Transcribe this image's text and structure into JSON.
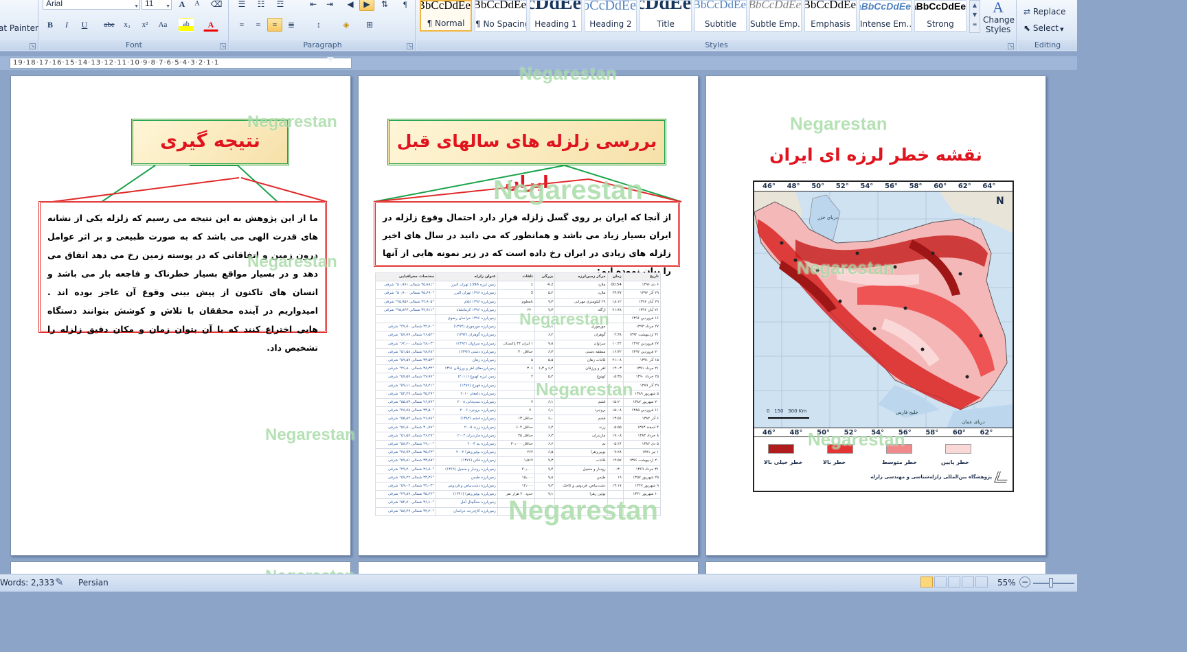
{
  "ribbon": {
    "clipboard": {
      "format_painter": "at Painter"
    },
    "font": {
      "family": "Arial",
      "size": "11",
      "group_label": "Font",
      "buttons": [
        "B",
        "I",
        "U",
        "abe",
        "x₂",
        "x²",
        "Aa",
        "ab",
        "A"
      ],
      "grow": "A",
      "shrink": "A"
    },
    "paragraph": {
      "group_label": "Paragraph"
    },
    "styles": {
      "group_label": "Styles",
      "tiles": [
        {
          "sample": "AaBbCcDdEe",
          "name": "¶ Normal"
        },
        {
          "sample": "AaBbCcDdEe",
          "name": "¶ No Spacing"
        },
        {
          "sample": "AaBbCcDdEe",
          "name": "Heading 1"
        },
        {
          "sample": "AaBbCcDdEe",
          "name": "Heading 2"
        },
        {
          "sample": "AaBbCcDdEe",
          "name": "Title"
        },
        {
          "sample": "AaBbCcDdEe",
          "name": "Subtitle"
        },
        {
          "sample": "AaBbCcDdEe",
          "name": "Subtle Emp..."
        },
        {
          "sample": "AaBbCcDdEe",
          "name": "Emphasis"
        },
        {
          "sample": "AaBbCcDdEe",
          "name": "Intense Em..."
        },
        {
          "sample": "AaBbCcDdEe",
          "name": "Strong"
        }
      ],
      "change_styles": "Change Styles"
    },
    "editing": {
      "group_label": "Editing",
      "replace": "Replace",
      "select": "Select"
    }
  },
  "ruler": {
    "text": "19·18·17·16·15·14·13·12·11·10·9·8·7·6·5·4·3·2·1·1"
  },
  "watermark": "Negarestan",
  "pages": {
    "left": {
      "banner": "نتیجه گیری",
      "body": "ما از این پژوهش به این نتیجه می رسیم که زلزله یکی از نشانه های قدرت الهی می باشد که به صورت طبیعی و بر اثر عوامل درون زمین و اتفاقاتی که در پوسته زمین رخ می دهد اتفاق می دهد و در بسیار مواقع بسیار خطرناک و فاجعه بار می باشد و انسان های تاکنون از پیش بینی وقوع آن عاجز بوده اند . امیدواریم در آینده محققان با تلاش و کوشش بتوانند دستگاه هایی اختراع کنند که با آن بتوان زمان و مکان دقیق زلزله را تشخیص داد."
    },
    "middle": {
      "banner": "بررسی زلزله های سالهای قبل ایران",
      "body": "از آنجا که ایران بر روی گسل زلزله قرار دارد احتمال وقوع زلزله در ایران بسیار زیاد می باشد و همانطور که می دانید در سال های اخیر زلزله های زیادی در ایران رخ داده است که در زیر نمونه هایی از آنها را بیان نموده ایم:",
      "table": {
        "headers": [
          "تاریخ",
          "زمان",
          "مرکز زمین‌لرزه",
          "بزرگی",
          "تلفات",
          "عنوان زلزله",
          "مختصات جغرافیایی"
        ],
        "rows": [
          [
            "۶ دی ۱۳۹۶",
            "00:54",
            "ملارد",
            "4.2",
            "1",
            "زمین لرزه 1396 تهران البرز",
            "۳۵٫۷۸۱° شمالی ۵۰٫۹۷۱° شرقی"
          ],
          [
            "۲۹ آذر ۱۳۹۶",
            "۲۳:۳۷",
            "ملارد",
            "۵٫۲",
            "3",
            "زمین‌لرزه ۱۳۹۶ تهران البرز",
            "۳۵٫۶۹۰° شمالی ۵۰٫۹۰۰° شرقی"
          ],
          [
            "۲۹ آبان ۱۳۹۶",
            "۱۸:۱۲",
            "۲۹ کیلومتری مهرانی",
            "۷٫۳",
            "نامعلوم",
            "زمین‌لرزه ۱۳۹۶ ایلام",
            "۳۴٫۹۰۵° شمالی ۴۵٫۹۵۶° شرقی"
          ],
          [
            "۲۱ آبان ۱۳۹۶",
            "۲۱:۴۸",
            "ازگله",
            "۷٫۳",
            "۶۲۰",
            "زمین‌لرزه ۱۳۹۶ کرمانشاه",
            "۳۴٫۹۱۱° شمالی ۴۵٫۸۴۳° شرقی"
          ],
          [
            "۱۶ فروردین ۱۳۹۶",
            "",
            "",
            "",
            "",
            "زمین‌لرزه ۱۳۹۶ خراسان رضوی",
            ""
          ],
          [
            "۲۷ مرداد ۱۳۹۳",
            "",
            "مورموری",
            "۶٫۱",
            "",
            "زمین‌لرزه مورموری (۱۳۹۳)",
            "۳۲٫۷۰° شمالی ۴۷٫۷۰° شرقی"
          ],
          [
            "۳۱ اردیبهشت ۱۳۹۲",
            "۰۲:۳۸",
            "گوهران",
            "۶٫۲",
            "",
            "زمین‌لرزه گوهران (۱۳۹۲)",
            "۲۶٫۵۲° شمالی ۵۷٫۷۷° شرقی"
          ],
          [
            "۲۷ فروردین ۱۳۹۲",
            "۱۰:۴۴",
            "سراوان",
            "۷٫۸",
            "۱ ایران ۳۴ پاکستان",
            "زمین‌لرزه سراوان (۱۳۹۲)",
            "۲۸٫۰۳° شمالی ۶۲٫۰۰° شرقی"
          ],
          [
            "۲۰ فروردین ۱۳۹۲",
            "۱۶:۳۲",
            "منطقه دشتی",
            "۶٫۳",
            "حداقل ۳۰",
            "زمین‌لرزه دشتی (۱۳۹۲)",
            "۲۸٫۴۸° شمالی ۵۱٫۵۸° شرقی"
          ],
          [
            "۱۵ آذر ۱۳۹۱",
            "۲۱:۰۸",
            "قائنات زهان",
            "۵٫۵",
            "۵",
            "زمین‌لرزه زهان",
            "۳۳٫۵۳° شمالی ۵۹٫۵۷° شرقی"
          ],
          [
            "۲۱ مرداد ۱۳۹۱",
            "۱۲:۰۳",
            "اهر و ورزقان",
            "۶٫۴ و ۶٫۳",
            "۳۰۶",
            "زمین‌لرزه‌های اهر و ورزقان ۱۳۹۱",
            "۳۸٫۳۲° شمالی ۴۶٫۸۰° شرقی"
          ],
          [
            "۲۵ خرداد ۱۳۹۰",
            "۰۵:۳۵",
            "کهنوج",
            "۵٫۴",
            "۲",
            "زمین لرزه کهنوج (۲۰۱۱)",
            "۲۷٫۹۷° شمالی ۵۷٫۵۷° شرقی"
          ],
          [
            "۲۹ آذر ۱۳۸۹",
            "",
            "",
            "",
            "",
            "زمین‌لرزه فهرج (۱۳۸۹)",
            "۲۸٫۴۱° شمالی ۵۹٫۱۱° شرقی"
          ],
          [
            "۵ شهریور ۱۳۸۹",
            "",
            "",
            "",
            "",
            "زمین‌لرزه دامغان ۲۰۱۰",
            "۳۵٫۴۹° شمالی ۵۴٫۴۷° شرقی"
          ],
          [
            "۲۰ شهریور ۱۳۸۷",
            "۱۵:۲۰",
            "قشم",
            "۶٫۱",
            "۷",
            "زمین‌لرزه سدیجانی ۲۰۰۸",
            "۲۶٫۷۷° شمالی ۵۵٫۸۳° شرقی"
          ],
          [
            "۱۱ فروردین ۱۳۸۵",
            "۱۵:۰۸",
            "بروجرد",
            "۶٫۱",
            "۷۰",
            "زمین‌لرزه بروجرد ۲۰۰۶",
            "۳۳٫۵۰° شمالی ۴۸٫۷۸° شرقی"
          ],
          [
            "۶ آذر ۱۳۸۴",
            "۱۳:۵۶",
            "قشم",
            "۶٫۰",
            "حداقل ۱۳",
            "زمین‌لرزه قشم (۱۳۸۴)",
            "۲۶٫۷۸° شمالی ۵۵٫۸۴° شرقی"
          ],
          [
            "۴ اسفند ۱۳۸۳",
            "۰۵:۵۵",
            "زرند",
            "۶٫۴",
            "حداقل ۶۰۲",
            "زمین‌لرزه زرند ۲۰۰۵",
            "۳۰٫۷۸° شمالی ۵۶٫۸۰° شرقی"
          ],
          [
            "۸ خرداد ۱۳۸۳",
            "۱۷:۰۸",
            "مازندران",
            "۶٫۳",
            "حداقل ۳۵",
            "زمین‌لرزه مازندران ۲۰۰۴",
            "۳۶٫۲۷° شمالی ۵۱٫۵۷° شرقی"
          ],
          [
            "۵ دی ۱۳۸۲",
            "۰۵:۲۶",
            "بم",
            "۶٫۶",
            "حداقل ۳۰٫۰۰۰",
            "زمین‌لرزه بم ۲۰۰۳",
            "۲۹٫۰۰° شمالی ۵۸٫۳۱° شرقی"
          ],
          [
            "۱ تیر ۱۳۸۱",
            "۰۷:۲۸",
            "بویین‌زهرا",
            "۶٫۵",
            "۲۶۲",
            "زمین‌لرزه بوئین‌زهرا ۲۰۰۲",
            "۳۵٫۶۳° شمالی ۴۸٫۹۳° شرقی"
          ],
          [
            "۲۰ اردیبهشت ۱۳۷۶",
            "۱۲:۵۷",
            "قائنات",
            "۷٫۳",
            "۱٫۵۶۷",
            "زمین‌لرزه قائن (۱۳۷۶)",
            "۳۳٫۸۵° شمالی ۵۹٫۸۱° شرقی"
          ],
          [
            "۳۱ خرداد ۱۳۶۹",
            "۰۰:۳۰",
            "رودبار و منجیل",
            "۷٫۴",
            "۴۰٫۰۰۰",
            "زمین‌لرزه رودبار و منجیل (۱۳۶۹)",
            "۳۶٫۸۰° شمالی ۴۹٫۴۰° شرقی"
          ],
          [
            "۲۵ شهریور ۱۳۵۷",
            "۱۹",
            "طبس",
            "۷٫۸",
            "۱۵٫۰۰۰",
            "زمین‌لرزه طبس",
            "۳۳٫۳۶° شمالی ۵۷٫۴۴° شرقی"
          ],
          [
            "۹ شهریور ۱۳۴۷",
            "۱۳:۱۷",
            "دشت‌بیاض، فردوس و کاخک",
            "۷٫۳",
            "۱۲٫۰۰۰",
            "زمین‌لرزه دشت‌بیاض و فردوس",
            "۳۴٫۰۳° شمالی ۵۹٫۰۴° شرقی"
          ],
          [
            "۱۰ شهریور ۱۳۴۱",
            "",
            "بوئین زهرا",
            "۷٫۱",
            "حدود ۲۰ هزار نفر",
            "زمین‌لرزه بوئین‌زهرا (۱۳۴۱)",
            "۳۵٫۶۲° شمالی ۴۹٫۸۷° شرقی"
          ],
          [
            "",
            "",
            "",
            "",
            "",
            "زمین‌لرزه سنگچال آمل",
            "۳۶٫۱۰° شمالی ۵۲٫۷۰° شرقی"
          ],
          [
            "",
            "",
            "",
            "",
            "",
            "زمین‌لرزه کاخ‌درجه خراسان",
            "۳۴٫۲۰° شمالی ۵۸٫۴۹° شرقی"
          ]
        ]
      }
    },
    "right": {
      "title": "نقشه خطر لرزه ای ایران",
      "map": {
        "lon_top": [
          "46°",
          "48°",
          "50°",
          "52°",
          "54°",
          "56°",
          "58°",
          "60°",
          "62°",
          "64°"
        ],
        "lon_bottom": [
          "46°",
          "48°",
          "50°",
          "52°",
          "54°",
          "56°",
          "58°",
          "60°",
          "62°"
        ],
        "caspian": "دریای خزر",
        "gulf": "خلیج فارس",
        "oman": "دریای عمان",
        "scale": "0   150   300 Km",
        "north": "N",
        "legend": [
          {
            "label": "خطر خیلی بالا",
            "color": "#b01c1c"
          },
          {
            "label": "خطر بالا",
            "color": "#e43333"
          },
          {
            "label": "خطر متوسط",
            "color": "#f08a8a"
          },
          {
            "label": "خطر پایین",
            "color": "#fbd8d8"
          }
        ],
        "institute": "پژوهشگاه بین‌المللی زلزله‌شناسی و مهندسی زلزله"
      }
    }
  },
  "status": {
    "words": "Words: 2,333",
    "language": "Persian",
    "zoom": "55%"
  }
}
